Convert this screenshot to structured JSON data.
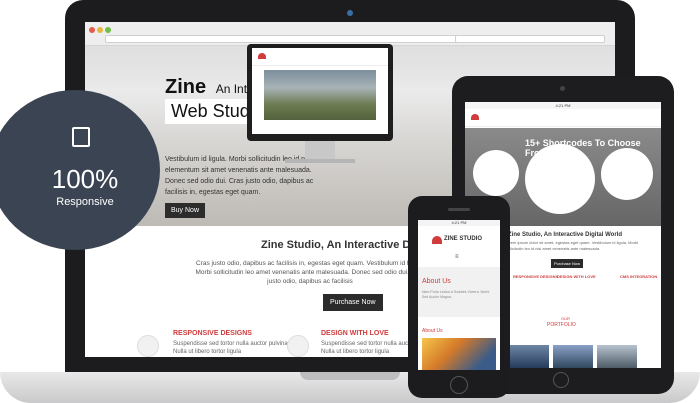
{
  "laptop": {
    "hero": {
      "title": "Zine",
      "subtitle": "An Interactive",
      "box_text": "Web Studio",
      "body": "Vestibulum id ligula. Morbi sollicitudin leo id nisl elementum sit amet venenatis ante malesuada. Donec sed odio dui. Cras justo odio, dapibus ac facilisis in, egestas eget quam.",
      "button": "Buy Now"
    },
    "content": {
      "title": "Zine Studio, An Interactive Digital",
      "body": "Cras justo odio, dapibus ac facilisis in, egestas eget quam. Vestibulum id ligula. Morbi sollicitudin leo amet venenatis ante malesuada. Donec sed odio dui. Cras justo odio, dapibus ac facilisis",
      "button": "Purchase Now"
    },
    "features": [
      {
        "title": "RESPONSIVE DESIGNS",
        "text": "Suspendisse sed tortor nulla auctor pulvinar. Nulla ut libero tortor ligula"
      },
      {
        "title": "DESIGN WITH LOVE",
        "text": "Suspendisse sed tortor nulla auctor pulvinar. Nulla ut libero tortor ligula"
      }
    ]
  },
  "badge": {
    "value": "100%",
    "label": "Responsive"
  },
  "tablet": {
    "status": "4:21 PM",
    "hero_title": "15+ Shortcodes To Choose From",
    "title": "Zine Studio, An Interactive Digital World",
    "body": "Lorem ipsum dolor sit amet, egestas eget quam. Vestibulum id ligula. Morbi sollicitudin leo id nisl amet venenatis ante malesuada.",
    "button": "Purchase Now",
    "features": [
      "RESPONSIVE DESIGNS",
      "DESIGN WITH LOVE",
      "CMS INTEGRATION"
    ],
    "portfolio_label": "PORTFOLIO",
    "portfolio_top": "OUR"
  },
  "phone": {
    "status": "4:21 PM",
    "logo": "ZINE STUDIO",
    "about_title": "About Us",
    "about_text": "Nam Porta Lectus A Sodales Viverra. Morbi Sed Auctor Magna.",
    "about_label": "About Us"
  },
  "colors": {
    "accent": "#d03b3b",
    "dark": "#2b2b2b",
    "badge": "#3a4453"
  }
}
